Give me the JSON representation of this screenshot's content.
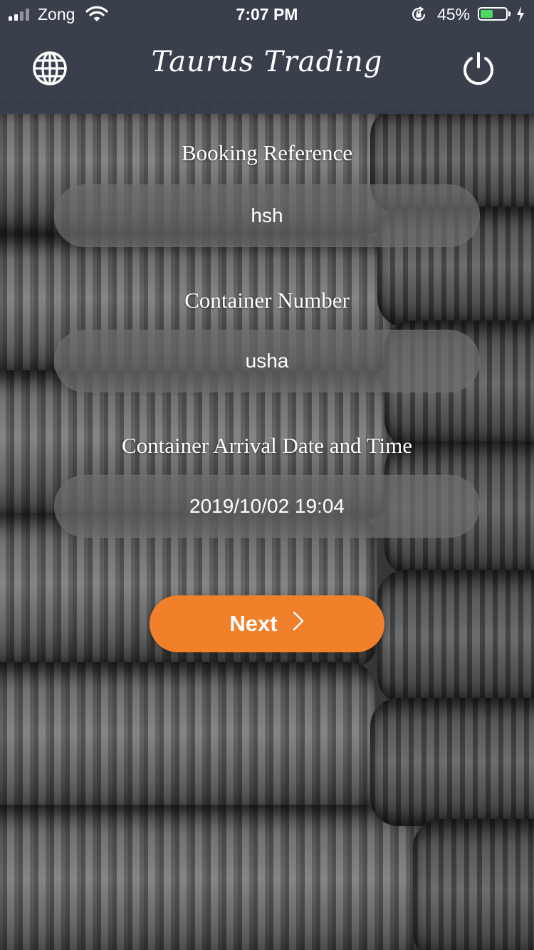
{
  "status_bar": {
    "carrier": "Zong",
    "time": "7:07 PM",
    "battery_percent": "45%",
    "battery_level": 0.45,
    "signal_bars": 2
  },
  "header": {
    "title": "Taurus Trading",
    "left_icon": "globe-icon",
    "right_icon": "power-icon"
  },
  "form": {
    "booking_reference": {
      "label": "Booking Reference",
      "value": "hsh"
    },
    "container_number": {
      "label": "Container Number",
      "value": "usha"
    },
    "arrival": {
      "label": "Container Arrival Date and Time",
      "value": "2019/10/02 19:04"
    },
    "next_button": {
      "label": "Next",
      "icon": "chevron-right-icon"
    }
  },
  "colors": {
    "accent": "#f0802a",
    "header_bg": "#3a404e",
    "battery_green": "#4cd964"
  }
}
